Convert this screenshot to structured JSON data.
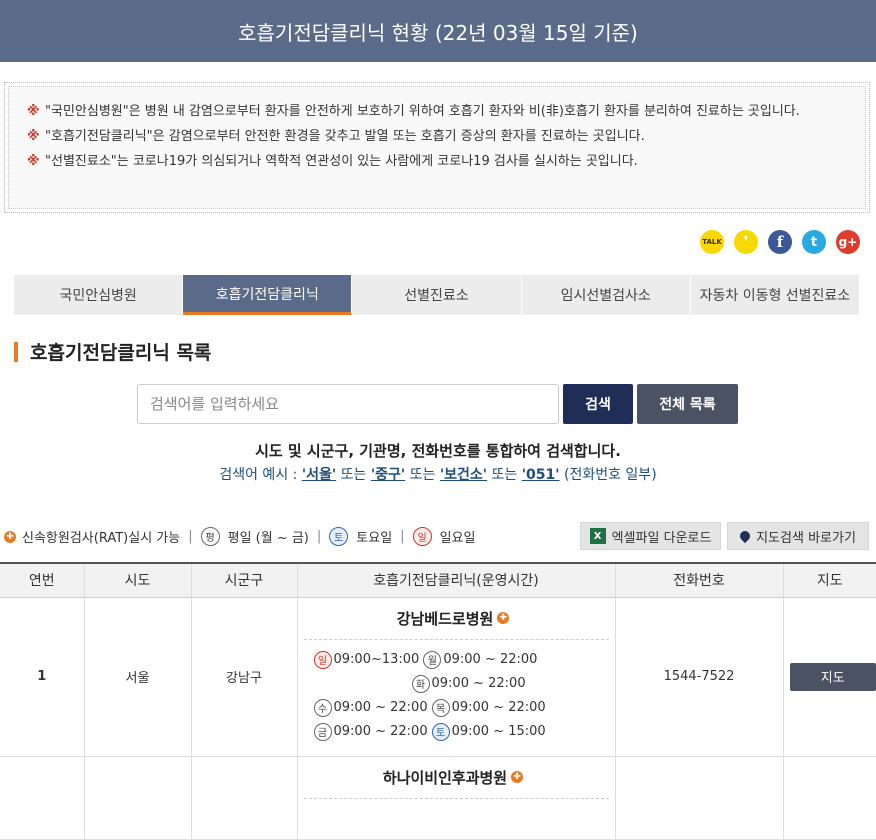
{
  "header": {
    "title": "호흡기전담클리닉 현황 (22년 03월 15일 기준)"
  },
  "notice": {
    "mark": "※",
    "items": [
      "\"국민안심병원\"은 병원 내 감염으로부터 환자를 안전하게 보호하기 위하여 호흡기 환자와 비(非)호흡기 환자를 분리하여 진료하는 곳입니다.",
      "\"호흡기전담클리닉\"은 감염으로부터 안전한 환경을 갖추고 발열 또는 호흡기 증상의 환자를 진료하는 곳입니다.",
      "\"선별진료소\"는 코로나19가 의심되거나 역학적 연관성이 있는 사람에게 코로나19 검사를 실시하는 곳입니다."
    ]
  },
  "sns": {
    "kakaotalk": "TALK",
    "kakaostory": "❜",
    "facebook": "f",
    "twitter": "t",
    "google": "g+"
  },
  "tabs": [
    "국민안심병원",
    "호흡기전담클리닉",
    "선별진료소",
    "임시선별검사소",
    "자동차 이동형 선별진료소"
  ],
  "section": {
    "title": "호흡기전담클리닉 목록"
  },
  "search": {
    "placeholder": "검색어를 입력하세요",
    "button": "검색",
    "all_button": "전체 목록",
    "desc": "시도 및 시군구, 기관명, 전화번호를 통합하여 검색합니다.",
    "example_prefix": "검색어 예시 :",
    "ex1": "'서울'",
    "or1": "또는",
    "ex2": "'중구'",
    "or2": "또는",
    "ex3": "'보건소'",
    "or3": "또는",
    "ex4": "'051'",
    "ex4_note": "(전화번호 일부)"
  },
  "legend": {
    "rat": "신속항원검사(RAT)실시 가능",
    "weekday_icon": "평",
    "weekday": "평일 (월 ~ 금)",
    "sat_icon": "토",
    "saturday": "토요일",
    "sun_icon": "일",
    "sunday": "일요일"
  },
  "buttons": {
    "excel": "엑셀파일 다운로드",
    "excel_icon": "X",
    "map": "지도검색 바로가기"
  },
  "table": {
    "headers": [
      "연번",
      "시도",
      "시군구",
      "호흡기전담클리닉(운영시간)",
      "전화번호",
      "지도"
    ],
    "rows": [
      {
        "no": "1",
        "sido": "서울",
        "sigungu": "강남구",
        "name": "강남베드로병원",
        "phone": "1544-7522",
        "map": "지도",
        "hours": [
          {
            "d1": "일",
            "t1": "09:00~13:00",
            "d2": "월",
            "t2": "09:00 ~ 22:00"
          },
          {
            "d2": "화",
            "t2": "09:00 ~ 22:00"
          },
          {
            "d1": "수",
            "t1": "09:00 ~ 22:00",
            "d2": "목",
            "t2": "09:00 ~ 22:00"
          },
          {
            "d1": "금",
            "t1": "09:00 ~ 22:00",
            "d2": "토",
            "t2": "09:00 ~ 15:00"
          }
        ]
      },
      {
        "no": "",
        "sido": "",
        "sigungu": "",
        "name": "하나이비인후과병원",
        "phone": "",
        "map": ""
      }
    ]
  }
}
